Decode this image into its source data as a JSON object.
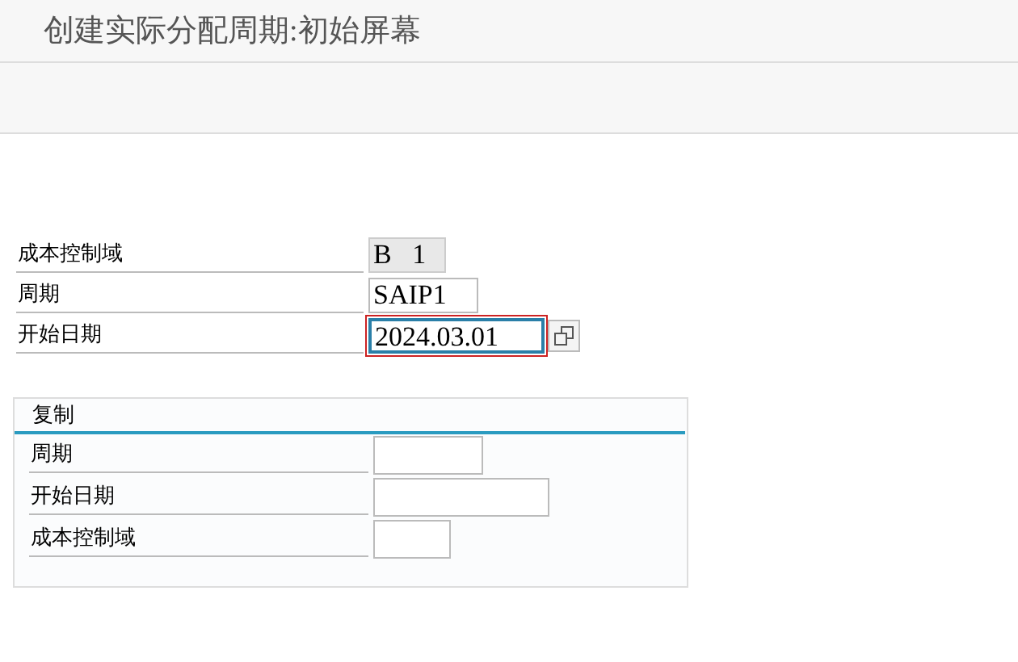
{
  "window": {
    "title": "创建实际分配周期:初始屏幕"
  },
  "fields": [
    {
      "label": "成本控制域",
      "value": "B   1",
      "readonly": true,
      "focused": false
    },
    {
      "label": "周期",
      "value": "SAIP1",
      "readonly": false,
      "focused": false
    },
    {
      "label": "开始日期",
      "value": "2024.03.01",
      "readonly": false,
      "focused": true,
      "help": true
    }
  ],
  "copy_group": {
    "title": "复制",
    "fields": [
      {
        "label": "周期",
        "readonly": false,
        "focused": false
      },
      {
        "label": "开始日期",
        "readonly": false,
        "focused": false
      },
      {
        "label": "成本控制域",
        "readonly": false,
        "focused": false
      }
    ]
  }
}
